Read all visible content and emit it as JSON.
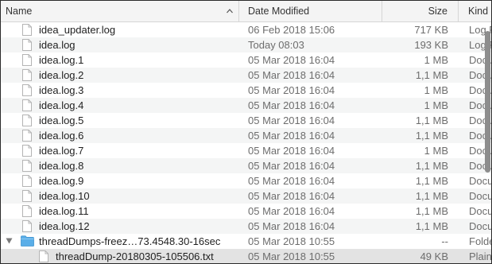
{
  "columns": {
    "name": "Name",
    "date": "Date Modified",
    "size": "Size",
    "kind": "Kind"
  },
  "rows": [
    {
      "name": "idea_updater.log",
      "date": "06 Feb 2018 15:06",
      "size": "717 KB",
      "kind": "Log F"
    },
    {
      "name": "idea.log",
      "date": "Today 08:03",
      "size": "193 KB",
      "kind": "Log F"
    },
    {
      "name": "idea.log.1",
      "date": "05 Mar 2018 16:04",
      "size": "1 MB",
      "kind": "Docu"
    },
    {
      "name": "idea.log.2",
      "date": "05 Mar 2018 16:04",
      "size": "1,1 MB",
      "kind": "Docu"
    },
    {
      "name": "idea.log.3",
      "date": "05 Mar 2018 16:04",
      "size": "1 MB",
      "kind": "Docu"
    },
    {
      "name": "idea.log.4",
      "date": "05 Mar 2018 16:04",
      "size": "1 MB",
      "kind": "Docu"
    },
    {
      "name": "idea.log.5",
      "date": "05 Mar 2018 16:04",
      "size": "1,1 MB",
      "kind": "Docu"
    },
    {
      "name": "idea.log.6",
      "date": "05 Mar 2018 16:04",
      "size": "1,1 MB",
      "kind": "Docu"
    },
    {
      "name": "idea.log.7",
      "date": "05 Mar 2018 16:04",
      "size": "1 MB",
      "kind": "Docu"
    },
    {
      "name": "idea.log.8",
      "date": "05 Mar 2018 16:04",
      "size": "1,1 MB",
      "kind": "Docu"
    },
    {
      "name": "idea.log.9",
      "date": "05 Mar 2018 16:04",
      "size": "1,1 MB",
      "kind": "Docu"
    },
    {
      "name": "idea.log.10",
      "date": "05 Mar 2018 16:04",
      "size": "1,1 MB",
      "kind": "Docu"
    },
    {
      "name": "idea.log.11",
      "date": "05 Mar 2018 16:04",
      "size": "1,1 MB",
      "kind": "Docu"
    },
    {
      "name": "idea.log.12",
      "date": "05 Mar 2018 16:04",
      "size": "1,1 MB",
      "kind": "Docu"
    }
  ],
  "folder": {
    "name": "threadDumps-freez…73.4548.30-16sec",
    "date": "05 Mar 2018 10:55",
    "size": "--",
    "kind": "Folde"
  },
  "child": {
    "name": "threadDump-20180305-105506.txt",
    "date": "05 Mar 2018 10:55",
    "size": "49 KB",
    "kind": "Plain"
  },
  "colors": {
    "folder": "#5aaee8",
    "selection": "#e3e3e3",
    "stripe": "#f4f5f5",
    "secondary_text": "#6d6d6d"
  },
  "icons": {
    "sort": "chevron-up-icon",
    "file": "document-icon",
    "folder": "folder-icon",
    "disclosure": "disclosure-triangle-icon"
  }
}
